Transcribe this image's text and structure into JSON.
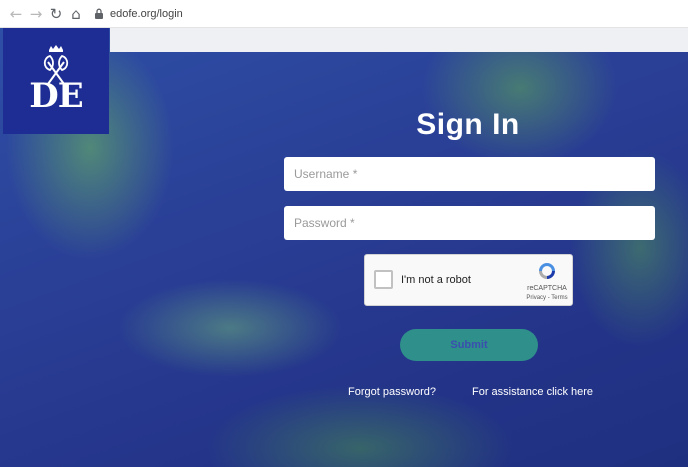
{
  "browser": {
    "back_icon": "arrow-left-icon",
    "forward_icon": "arrow-right-icon",
    "reload_icon": "reload-icon",
    "home_icon": "home-icon",
    "lock_icon": "lock-icon",
    "url": "edofe.org/login"
  },
  "logo": {
    "text": "DE",
    "icon": "dofe-crest-icon"
  },
  "login": {
    "title": "Sign In",
    "username_placeholder": "Username *",
    "password_placeholder": "Password *",
    "submit_label": "Submit",
    "forgot_password": "Forgot password?",
    "assistance": "For assistance click here"
  },
  "captcha": {
    "label": "I'm not a robot",
    "brand": "reCAPTCHA",
    "links": "Privacy - Terms",
    "icon": "recaptcha-icon"
  },
  "colors": {
    "brand_blue": "#1d2d94",
    "overlay_green": "#5fb85a",
    "submit_teal": "#2f8f8a"
  }
}
